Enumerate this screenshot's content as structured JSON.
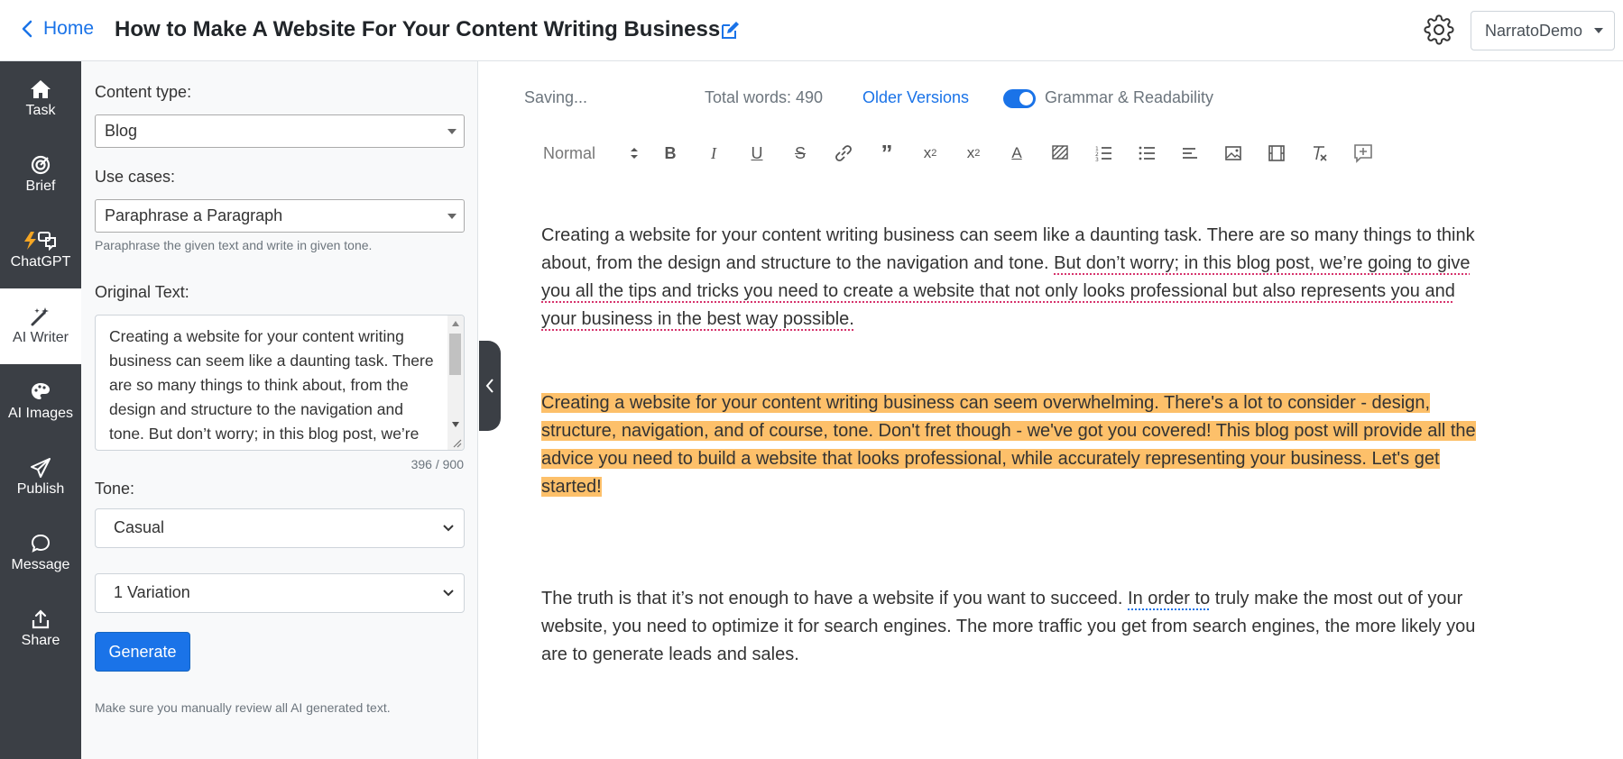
{
  "header": {
    "home_label": "Home",
    "title": "How to Make A Website For Your Content Writing Business",
    "user_menu": "NarratoDemo"
  },
  "rail": {
    "items": [
      {
        "label": "Task",
        "icon": "home-icon"
      },
      {
        "label": "Brief",
        "icon": "target-icon"
      },
      {
        "label": "ChatGPT",
        "icon": "chat-bolt-icon"
      },
      {
        "label": "AI Writer",
        "icon": "magic-wand-icon",
        "active": true
      },
      {
        "label": "AI Images",
        "icon": "palette-icon"
      },
      {
        "label": "Publish",
        "icon": "send-icon"
      },
      {
        "label": "Message",
        "icon": "message-icon"
      },
      {
        "label": "Share",
        "icon": "share-icon"
      }
    ]
  },
  "panel": {
    "content_type_label": "Content type:",
    "content_type_value": "Blog",
    "use_cases_label": "Use cases:",
    "use_case_value": "Paraphrase a Paragraph",
    "use_case_hint": "Paraphrase the given text and write in given tone.",
    "original_text_label": "Original Text:",
    "original_text": "Creating a website for your content writing business can seem like a daunting task. There are so many things to think about, from the design and structure to the navigation and tone. But don’t worry; in this blog post, we’re going to give you all the tips and tricks you need to create a website that not only looks professional but also represents you and your business in the best way possible.",
    "char_count": "396 / 900",
    "tone_label": "Tone:",
    "tone_value": "Casual",
    "variations_value": "1 Variation",
    "generate_label": "Generate",
    "footnote": "Make sure you manually review all AI generated text."
  },
  "editor": {
    "status": "Saving...",
    "word_count": "Total words: 490",
    "older_versions": "Older Versions",
    "grammar_toggle_label": "Grammar & Readability",
    "grammar_toggle_on": true,
    "format_select": "Normal",
    "p1_a": "Creating a website for your content writing business can seem like a daunting task. There are so many things to think about, from the design and structure to the navigation and tone. ",
    "p1_b": "But don’t worry; in this blog post, we’re going to give you all the tips and tricks you need to create a website that not only looks professional but also represents you and your business in the best way possible.",
    "p2": "Creating a website for your content writing business can seem overwhelming. There's a lot to consider - design, structure, navigation, and of course, tone. Don't fret though - we've got you covered! This blog post will provide all the advice you need to build a website that looks professional, while accurately representing your business. Let's get started!",
    "p3_a": "The truth is that it’s not enough to have a website if you want to succeed. ",
    "p3_b": "In order to",
    "p3_c": " truly make the most out of your website, you need to optimize it for search engines. The more traffic you get from search engines, the more likely you are to generate leads and sales."
  },
  "colors": {
    "accent": "#1a73e8",
    "rail_bg": "#3b3f45",
    "highlight": "#fdc06a"
  }
}
